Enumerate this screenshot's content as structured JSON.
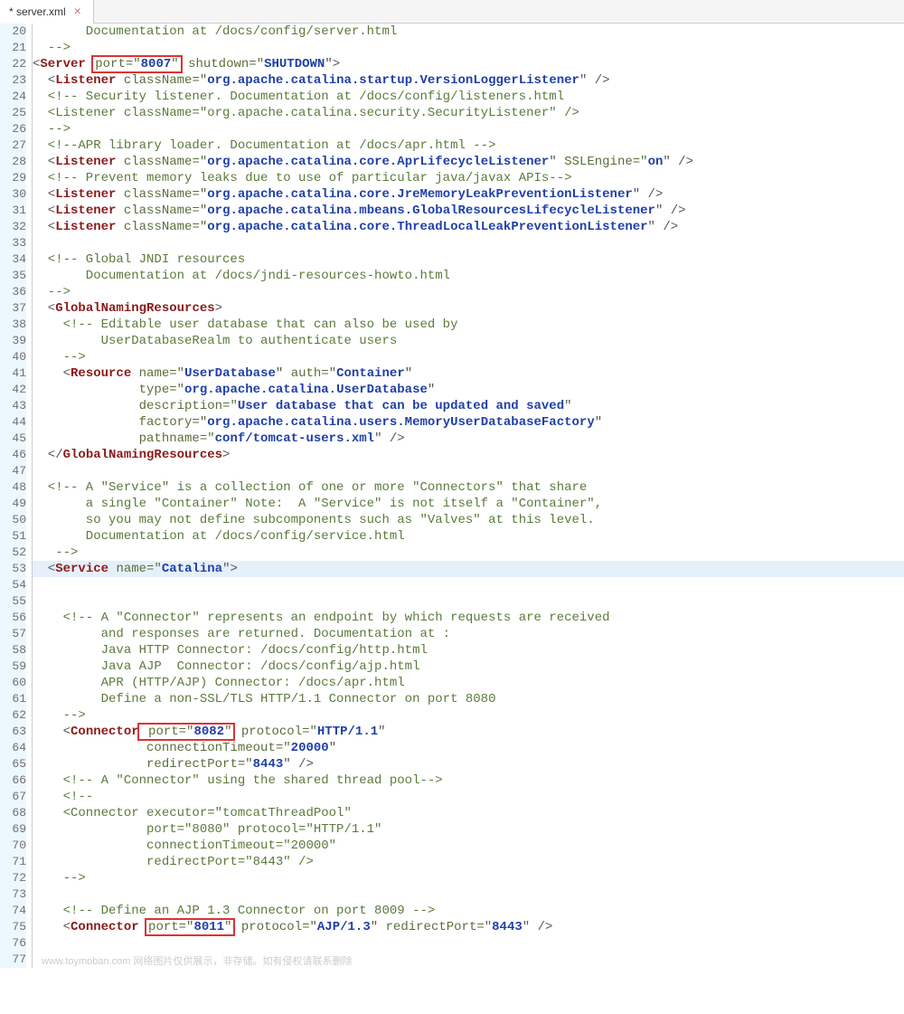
{
  "tab": {
    "label": "* server.xml"
  },
  "gutter": {
    "start": 20,
    "end": 77
  },
  "highlightLine": 53,
  "lines": {
    "20": [
      [
        "       Documentation at /docs/config/server.html",
        "cmt"
      ]
    ],
    "21": [
      [
        "  -->",
        "cmt"
      ]
    ],
    "22": [
      [
        "<",
        "p"
      ],
      [
        "Server",
        "k"
      ],
      [
        " ",
        "p"
      ],
      [
        "port=\"",
        "attr",
        "box"
      ],
      [
        "8007",
        "str",
        "box"
      ],
      [
        "\"",
        "attr",
        "box"
      ],
      [
        " ",
        "p"
      ],
      [
        "shutdown=\"",
        "attr"
      ],
      [
        "SHUTDOWN",
        "str"
      ],
      [
        "\">",
        "p"
      ]
    ],
    "23": [
      [
        "  <",
        "p"
      ],
      [
        "Listener",
        "k"
      ],
      [
        " ",
        "p"
      ],
      [
        "className=\"",
        "attr"
      ],
      [
        "org.apache.catalina.startup.VersionLoggerListener",
        "str"
      ],
      [
        "\" />",
        "p"
      ]
    ],
    "24": [
      [
        "  <!-- Security listener. Documentation at /docs/config/listeners.html",
        "cmt"
      ]
    ],
    "25": [
      [
        "  <Listener className=\"org.apache.catalina.security.SecurityListener\" />",
        "cmt"
      ]
    ],
    "26": [
      [
        "  -->",
        "cmt"
      ]
    ],
    "27": [
      [
        "  <!--APR library loader. Documentation at /docs/apr.html -->",
        "cmt"
      ]
    ],
    "28": [
      [
        "  <",
        "p"
      ],
      [
        "Listener",
        "k"
      ],
      [
        " ",
        "p"
      ],
      [
        "className=\"",
        "attr"
      ],
      [
        "org.apache.catalina.core.AprLifecycleListener",
        "str"
      ],
      [
        "\" ",
        "p"
      ],
      [
        "SSLEngine=\"",
        "attr"
      ],
      [
        "on",
        "str"
      ],
      [
        "\" />",
        "p"
      ]
    ],
    "29": [
      [
        "  <!-- Prevent memory leaks due to use of particular java/javax APIs-->",
        "cmt"
      ]
    ],
    "30": [
      [
        "  <",
        "p"
      ],
      [
        "Listener",
        "k"
      ],
      [
        " ",
        "p"
      ],
      [
        "className=\"",
        "attr"
      ],
      [
        "org.apache.catalina.core.JreMemoryLeakPreventionListener",
        "str"
      ],
      [
        "\" />",
        "p"
      ]
    ],
    "31": [
      [
        "  <",
        "p"
      ],
      [
        "Listener",
        "k"
      ],
      [
        " ",
        "p"
      ],
      [
        "className=\"",
        "attr"
      ],
      [
        "org.apache.catalina.mbeans.GlobalResourcesLifecycleListener",
        "str"
      ],
      [
        "\" />",
        "p"
      ]
    ],
    "32": [
      [
        "  <",
        "p"
      ],
      [
        "Listener",
        "k"
      ],
      [
        " ",
        "p"
      ],
      [
        "className=\"",
        "attr"
      ],
      [
        "org.apache.catalina.core.ThreadLocalLeakPreventionListener",
        "str"
      ],
      [
        "\" />",
        "p"
      ]
    ],
    "33": [
      [
        "",
        ""
      ]
    ],
    "34": [
      [
        "  <!-- Global JNDI resources",
        "cmt"
      ]
    ],
    "35": [
      [
        "       Documentation at /docs/jndi-resources-howto.html",
        "cmt"
      ]
    ],
    "36": [
      [
        "  -->",
        "cmt"
      ]
    ],
    "37": [
      [
        "  <",
        "p"
      ],
      [
        "GlobalNamingResources",
        "k"
      ],
      [
        ">",
        "p"
      ]
    ],
    "38": [
      [
        "    <!-- Editable user database that can also be used by",
        "cmt"
      ]
    ],
    "39": [
      [
        "         UserDatabaseRealm to authenticate users",
        "cmt"
      ]
    ],
    "40": [
      [
        "    -->",
        "cmt"
      ]
    ],
    "41": [
      [
        "    <",
        "p"
      ],
      [
        "Resource",
        "k"
      ],
      [
        " ",
        "p"
      ],
      [
        "name=\"",
        "attr"
      ],
      [
        "UserDatabase",
        "str"
      ],
      [
        "\" ",
        "p"
      ],
      [
        "auth=\"",
        "attr"
      ],
      [
        "Container",
        "str"
      ],
      [
        "\"",
        "p"
      ]
    ],
    "42": [
      [
        "              ",
        "p"
      ],
      [
        "type=\"",
        "attr"
      ],
      [
        "org.apache.catalina.UserDatabase",
        "str"
      ],
      [
        "\"",
        "p"
      ]
    ],
    "43": [
      [
        "              ",
        "p"
      ],
      [
        "description=\"",
        "attr"
      ],
      [
        "User database that can be updated and saved",
        "str"
      ],
      [
        "\"",
        "p"
      ]
    ],
    "44": [
      [
        "              ",
        "p"
      ],
      [
        "factory=\"",
        "attr"
      ],
      [
        "org.apache.catalina.users.MemoryUserDatabaseFactory",
        "str"
      ],
      [
        "\"",
        "p"
      ]
    ],
    "45": [
      [
        "              ",
        "p"
      ],
      [
        "pathname=\"",
        "attr"
      ],
      [
        "conf/tomcat-users.xml",
        "str"
      ],
      [
        "\" />",
        "p"
      ]
    ],
    "46": [
      [
        "  </",
        "p"
      ],
      [
        "GlobalNamingResources",
        "k"
      ],
      [
        ">",
        "p"
      ]
    ],
    "47": [
      [
        "",
        ""
      ]
    ],
    "48": [
      [
        "  <!-- A \"Service\" is a collection of one or more \"Connectors\" that share",
        "cmt"
      ]
    ],
    "49": [
      [
        "       a single \"Container\" Note:  A \"Service\" is not itself a \"Container\",",
        "cmt"
      ]
    ],
    "50": [
      [
        "       so you may not define subcomponents such as \"Valves\" at this level.",
        "cmt"
      ]
    ],
    "51": [
      [
        "       Documentation at /docs/config/service.html",
        "cmt"
      ]
    ],
    "52": [
      [
        "   -->",
        "cmt"
      ]
    ],
    "53": [
      [
        "  <",
        "p"
      ],
      [
        "Service",
        "k"
      ],
      [
        " ",
        "p"
      ],
      [
        "name=\"",
        "attr"
      ],
      [
        "Catalina",
        "str"
      ],
      [
        "\">",
        "p"
      ]
    ],
    "54": [
      [
        "",
        ""
      ]
    ],
    "55": [
      [
        "",
        ""
      ]
    ],
    "56": [
      [
        "    <!-- A \"Connector\" represents an endpoint by which requests are received",
        "cmt"
      ]
    ],
    "57": [
      [
        "         and responses are returned. Documentation at :",
        "cmt"
      ]
    ],
    "58": [
      [
        "         Java HTTP Connector: /docs/config/http.html",
        "cmt"
      ]
    ],
    "59": [
      [
        "         Java AJP  Connector: /docs/config/ajp.html",
        "cmt"
      ]
    ],
    "60": [
      [
        "         APR (HTTP/AJP) Connector: /docs/apr.html",
        "cmt"
      ]
    ],
    "61": [
      [
        "         Define a non-SSL/TLS HTTP/1.1 Connector on port 8080",
        "cmt"
      ]
    ],
    "62": [
      [
        "    -->",
        "cmt"
      ]
    ],
    "63": [
      [
        "    <",
        "p"
      ],
      [
        "Connector",
        "k"
      ],
      [
        " ",
        "p",
        "box"
      ],
      [
        "port=\"",
        "attr",
        "box"
      ],
      [
        "8082",
        "str",
        "box"
      ],
      [
        "\"",
        "attr",
        "box"
      ],
      [
        " ",
        "p"
      ],
      [
        "protocol=\"",
        "attr"
      ],
      [
        "HTTP/1.1",
        "str"
      ],
      [
        "\"",
        "p"
      ]
    ],
    "64": [
      [
        "               ",
        "p"
      ],
      [
        "connectionTimeout=\"",
        "attr"
      ],
      [
        "20000",
        "str"
      ],
      [
        "\"",
        "p"
      ]
    ],
    "65": [
      [
        "               ",
        "p"
      ],
      [
        "redirectPort=\"",
        "attr"
      ],
      [
        "8443",
        "str"
      ],
      [
        "\" />",
        "p"
      ]
    ],
    "66": [
      [
        "    <!-- A \"Connector\" using the shared thread pool-->",
        "cmt"
      ]
    ],
    "67": [
      [
        "    <!--",
        "cmt"
      ]
    ],
    "68": [
      [
        "    <Connector executor=\"tomcatThreadPool\"",
        "cmt"
      ]
    ],
    "69": [
      [
        "               port=\"8080\" protocol=\"HTTP/1.1\"",
        "cmt"
      ]
    ],
    "70": [
      [
        "               connectionTimeout=\"20000\"",
        "cmt"
      ]
    ],
    "71": [
      [
        "               redirectPort=\"8443\" />",
        "cmt"
      ]
    ],
    "72": [
      [
        "    -->",
        "cmt"
      ]
    ],
    "73": [
      [
        "",
        ""
      ]
    ],
    "74": [
      [
        "    <!-- Define an AJP 1.3 Connector on port 8009 -->",
        "cmt"
      ]
    ],
    "75": [
      [
        "    <",
        "p"
      ],
      [
        "Connector",
        "k"
      ],
      [
        " ",
        "p"
      ],
      [
        "port=\"",
        "attr",
        "box"
      ],
      [
        "8011",
        "str",
        "box"
      ],
      [
        "\"",
        "attr",
        "box"
      ],
      [
        " ",
        "p"
      ],
      [
        "protocol=\"",
        "attr"
      ],
      [
        "AJP/1.3",
        "str"
      ],
      [
        "\" ",
        "p"
      ],
      [
        "redirectPort=\"",
        "attr"
      ],
      [
        "8443",
        "str"
      ],
      [
        "\" />",
        "p"
      ]
    ],
    "76": [
      [
        "",
        ""
      ]
    ],
    "77": [
      [
        "",
        ""
      ]
    ]
  },
  "watermark": "www.toymoban.com  网络图片仅供展示，非存储。如有侵权请联系删除"
}
